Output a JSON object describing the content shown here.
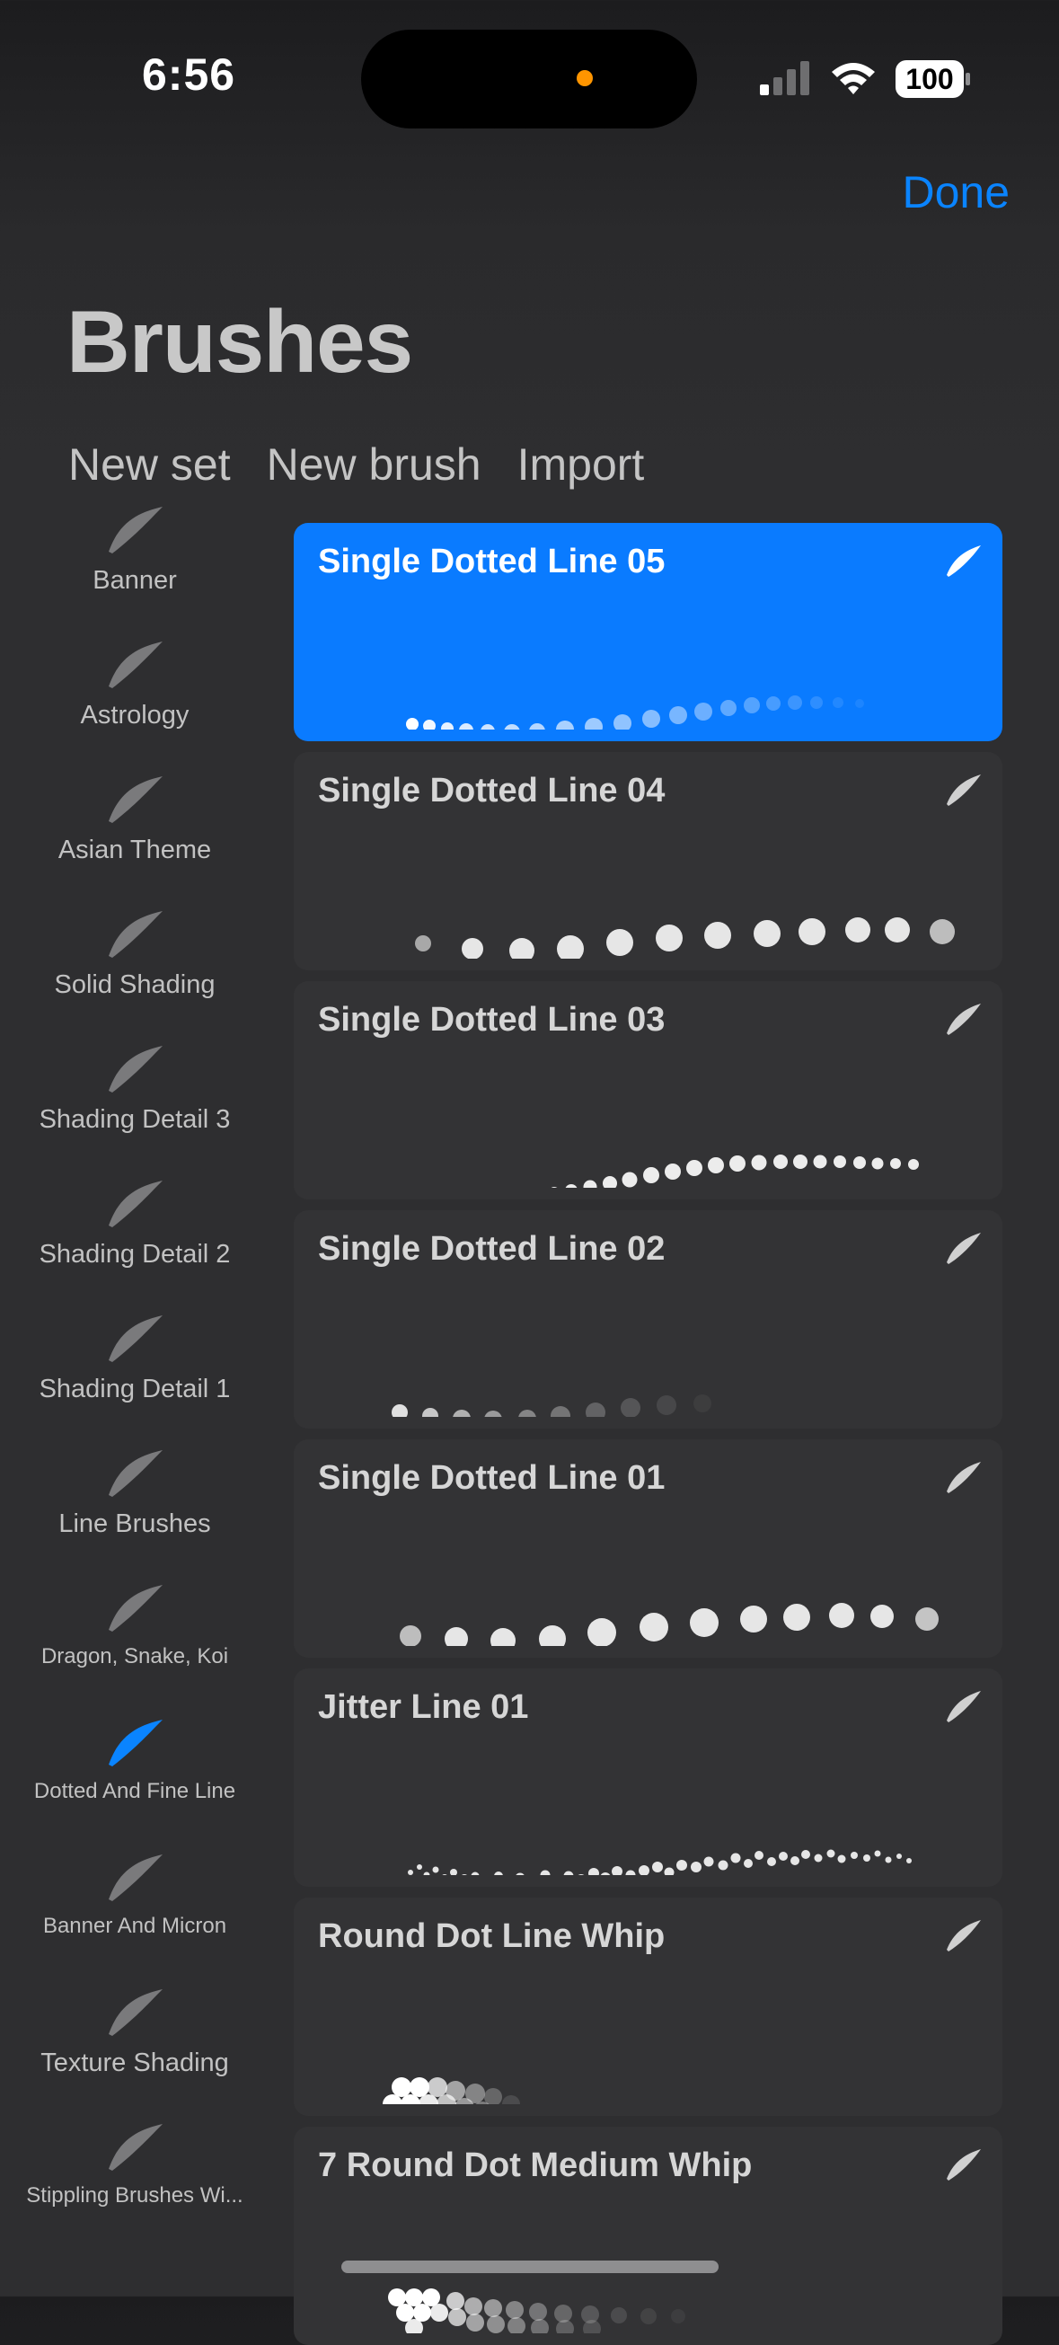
{
  "status": {
    "time": "6:56",
    "battery": "100",
    "island_dot_color": "#ff9500"
  },
  "header": {
    "done_label": "Done",
    "title": "Brushes"
  },
  "actions": {
    "new_set": "New set",
    "new_brush": "New brush",
    "import": "Import"
  },
  "accent_color": "#0a84ff",
  "selected_card_color": "#0a7bff",
  "sets": [
    {
      "label": "Banner"
    },
    {
      "label": "Astrology"
    },
    {
      "label": "Asian Theme"
    },
    {
      "label": "Solid Shading"
    },
    {
      "label": "Shading Detail 3"
    },
    {
      "label": "Shading Detail 2"
    },
    {
      "label": "Shading Detail 1"
    },
    {
      "label": "Line Brushes"
    },
    {
      "label": "Dragon, Snake, Koi"
    },
    {
      "label": "Dotted And Fine Line",
      "selected": true
    },
    {
      "label": "Banner And Micron"
    },
    {
      "label": "Texture Shading"
    },
    {
      "label": "Stippling Brushes Wi..."
    }
  ],
  "brushes": [
    {
      "name": "Single Dotted Line 05",
      "selected": true
    },
    {
      "name": "Single Dotted Line 04"
    },
    {
      "name": "Single Dotted Line 03"
    },
    {
      "name": "Single Dotted Line 02"
    },
    {
      "name": "Single Dotted Line 01"
    },
    {
      "name": "Jitter Line 01"
    },
    {
      "name": "Round Dot Line Whip"
    },
    {
      "name": "7 Round Dot Medium Whip"
    }
  ]
}
